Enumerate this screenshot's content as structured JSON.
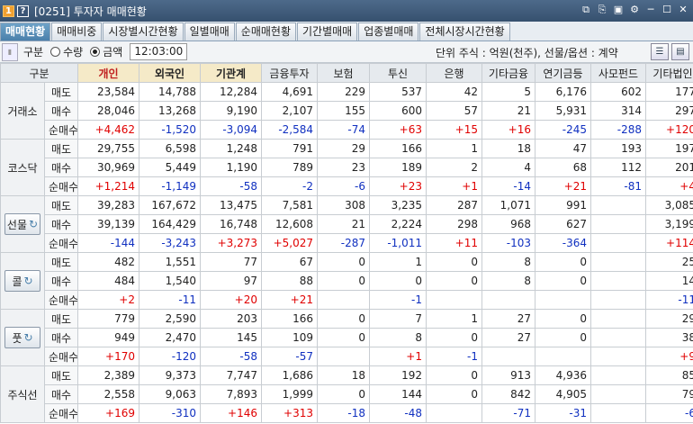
{
  "window": {
    "code": "1",
    "title": "[0251] 투자자 매매현황",
    "controls": [
      "⧉",
      "⎘",
      "▣",
      "⚙",
      "─",
      "☐",
      "✕"
    ]
  },
  "tabs": [
    {
      "label": "매매현황",
      "active": true
    },
    {
      "label": "매매비중",
      "active": false
    },
    {
      "label": "시장별시간현황",
      "active": false
    },
    {
      "label": "일별매매",
      "active": false
    },
    {
      "label": "순매매현황",
      "active": false
    },
    {
      "label": "기간별매매",
      "active": false
    },
    {
      "label": "업종별매매",
      "active": false
    },
    {
      "label": "전체시장시간현황",
      "active": false
    }
  ],
  "toolbar": {
    "section_label": "구분",
    "radio_qty": "수량",
    "radio_amt": "금액",
    "selected": "금액",
    "time": "12:03:00",
    "unit_text": "단위 주식 : 억원(천주), 선물/옵션 : 계약"
  },
  "colors": {
    "buy_pos": "#e00000",
    "sell_neg": "#1030c0",
    "active_tab": "#4a80ab"
  },
  "headers": [
    "구분",
    "개인",
    "외국인",
    "기관계",
    "금융투자",
    "보험",
    "투신",
    "은행",
    "기타금융",
    "연기금등",
    "사모펀드",
    "기타법인"
  ],
  "row_labels": {
    "sell": "매도",
    "buy": "매수",
    "net": "순매수"
  },
  "groups": [
    {
      "name": "거래소",
      "button": false,
      "sell": [
        "23,584",
        "14,788",
        "12,284",
        "4,691",
        "229",
        "537",
        "42",
        "5",
        "6,176",
        "602",
        "177"
      ],
      "buy": [
        "28,046",
        "13,268",
        "9,190",
        "2,107",
        "155",
        "600",
        "57",
        "21",
        "5,931",
        "314",
        "297"
      ],
      "net": [
        "+4,462",
        "-1,520",
        "-3,094",
        "-2,584",
        "-74",
        "+63",
        "+15",
        "+16",
        "-245",
        "-288",
        "+120"
      ]
    },
    {
      "name": "코스닥",
      "button": false,
      "sell": [
        "29,755",
        "6,598",
        "1,248",
        "791",
        "29",
        "166",
        "1",
        "18",
        "47",
        "193",
        "197"
      ],
      "buy": [
        "30,969",
        "5,449",
        "1,190",
        "789",
        "23",
        "189",
        "2",
        "4",
        "68",
        "112",
        "201"
      ],
      "net": [
        "+1,214",
        "-1,149",
        "-58",
        "-2",
        "-6",
        "+23",
        "+1",
        "-14",
        "+21",
        "-81",
        "+4"
      ]
    },
    {
      "name": "선물",
      "button": true,
      "sell": [
        "39,283",
        "167,672",
        "13,475",
        "7,581",
        "308",
        "3,235",
        "287",
        "1,071",
        "991",
        "",
        "3,085"
      ],
      "buy": [
        "39,139",
        "164,429",
        "16,748",
        "12,608",
        "21",
        "2,224",
        "298",
        "968",
        "627",
        "",
        "3,199"
      ],
      "net": [
        "-144",
        "-3,243",
        "+3,273",
        "+5,027",
        "-287",
        "-1,011",
        "+11",
        "-103",
        "-364",
        "",
        "+114"
      ]
    },
    {
      "name": "콜",
      "button": true,
      "sell": [
        "482",
        "1,551",
        "77",
        "67",
        "0",
        "1",
        "0",
        "8",
        "0",
        "",
        "25"
      ],
      "buy": [
        "484",
        "1,540",
        "97",
        "88",
        "0",
        "0",
        "0",
        "8",
        "0",
        "",
        "14"
      ],
      "net": [
        "+2",
        "-11",
        "+20",
        "+21",
        "",
        "-1",
        "",
        "",
        "",
        "",
        "-11"
      ]
    },
    {
      "name": "풋",
      "button": true,
      "sell": [
        "779",
        "2,590",
        "203",
        "166",
        "0",
        "7",
        "1",
        "27",
        "0",
        "",
        "29"
      ],
      "buy": [
        "949",
        "2,470",
        "145",
        "109",
        "0",
        "8",
        "0",
        "27",
        "0",
        "",
        "38"
      ],
      "net": [
        "+170",
        "-120",
        "-58",
        "-57",
        "",
        "+1",
        "-1",
        "",
        "",
        "",
        "+9"
      ]
    },
    {
      "name": "주식선",
      "button": false,
      "sell": [
        "2,389",
        "9,373",
        "7,747",
        "1,686",
        "18",
        "192",
        "0",
        "913",
        "4,936",
        "",
        "85"
      ],
      "buy": [
        "2,558",
        "9,063",
        "7,893",
        "1,999",
        "0",
        "144",
        "0",
        "842",
        "4,905",
        "",
        "79"
      ],
      "net": [
        "+169",
        "-310",
        "+146",
        "+313",
        "-18",
        "-48",
        "",
        "-71",
        "-31",
        "",
        "-6"
      ]
    }
  ]
}
